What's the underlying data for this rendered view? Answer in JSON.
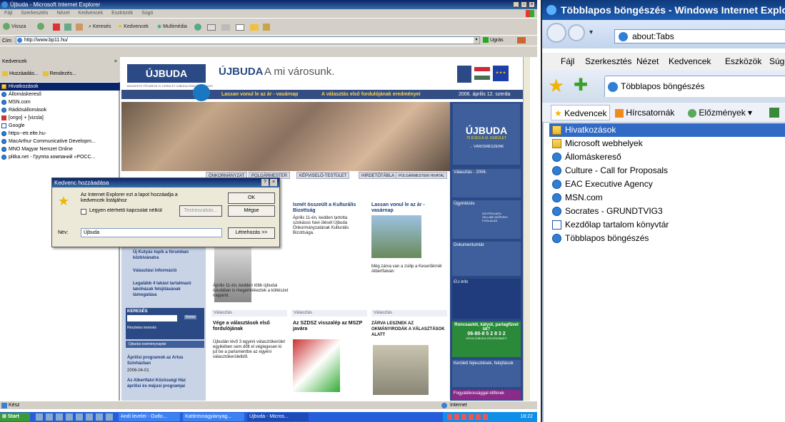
{
  "win1": {
    "title": "Újbuda - Microsoft Internet Explorer",
    "menu": [
      "Fájl",
      "Szerkesztés",
      "Nézet",
      "Kedvencek",
      "Eszközök",
      "Súgó"
    ],
    "toolbar": {
      "back": "Vissza",
      "search": "Keresés",
      "favorites": "Kedvencek",
      "media": "Multimédia"
    },
    "address_label": "Cím",
    "address": "http://www.bp11.hu/",
    "go": "Ugrás",
    "fav_title": "Kedvencek",
    "fav_add": "Hozzáadás...",
    "fav_org": "Rendezés...",
    "fav_items": [
      "Hivatkozások",
      "Állomáskereső",
      "MSN.com",
      "Rádiósállomások",
      "[origo] + [vizsla]",
      "Google",
      "https--etr.elte.hu-",
      "MacArthur Communicative Developm...",
      "MNO Magyar Nemzet Online",
      "plitka.net - Группа компаний «РОСС..."
    ],
    "status": "Kész",
    "status_zone": "Internet",
    "taskbar": {
      "start": "Start",
      "b1": "Andi levelei - Outlo...",
      "b2": "Kattintsnagyianyag...",
      "b3": "Újbuda - Micros...",
      "clock": "18:22"
    },
    "dialog": {
      "title": "Kedvenc hozzáadása",
      "msg": "Az Internet Explorer ezt a lapot hozzáadja a kedvencek listájához",
      "offline": "Legyen elérhető kapcsolat nélkül",
      "customize": "Testreszabás...",
      "ok": "OK",
      "cancel": "Mégse",
      "name_label": "Név:",
      "name_value": "Újbuda",
      "create": "Létrehozás >>"
    },
    "site": {
      "logo": "ÚJBUDA",
      "brand": "ÚJBUDA",
      "slogan": "A mi városunk.",
      "subtitle": "BUDAPEST FŐVÁROS XI. KERÜLET ÚJBUDA ÖNKORMÁNYZATA",
      "nav1": "Lassan vonul le az ár - vasárnap",
      "nav2": "A választás első fordulójának eredményei",
      "date": "2006. április 12. szerda",
      "hero_badge": "ÚJBUDA",
      "hero_badge2": "75 ÉVES A XI. KERÜLET",
      "hero_link": "→ VÁROSRÉSZEINK",
      "tabs": [
        "ÖNKORMÁNYZAT",
        "POLGÁRMESTER",
        "KÉPVISELŐ-TESTÜLET",
        "HIRDETŐTÁBLA",
        "POLGÁRMESTERI HIVATAL"
      ],
      "left_links": [
        "Új Kutyás topik a fórumban közkívánatra",
        "Választási információ",
        "Legalább 4 lakást tartalmazó lakóházak felújításának támogatása"
      ],
      "search_title": "KERESÉS",
      "search_btn": "Keres",
      "search_adv": "Részletes keresés",
      "events_title": "Újbudai eseménynaptár",
      "ev1": "Áprilisi programok az Artus Színházban",
      "ev1_date": "2006-04-01",
      "ev2": "Az Albertfalvi Közösségi Ház áprilisi és májusi programjai",
      "a1_title": "Ismét összeült a Kulturális Bizottság",
      "a1_text": "Április 11-én, kedden tartotta szokásos havi ülését Újbuda Önkormányzatának Kulturális Bizottsága.",
      "a2_title": "Lassan vonul le az ár - vasárnap",
      "a2_text": "Még zárva van a zsilip a Keserűérnél Albertfalván",
      "a3_text": "Április 11-én, kedden több újbudai iskolában is megemlékeztek a költészet napjáról.",
      "sec": "Választás",
      "b1_title": "Vége a választások első fordulójának",
      "b1_text": "Újbudán lévő 3 egyéni választókerület egyikében sem dőlt el véglegesen ki jut be a parlamentbe az egyéni választókerületből.",
      "b2_title": "Az SZDSZ visszalép az MSZP javára",
      "b3_title": "ZÁRVA LESZNEK AZ OKMÁNYIRODÁK A VÁLASZTÁSOK ALATT",
      "r1": "Választás - 2006.",
      "r2": "Ügyintézés",
      "r2b": "ÜGYFÉLKAPU",
      "r2c": "ON-LINE IDŐPONT-FOGLALÁS",
      "r3": "Dokumentumtár",
      "r4": "EU-Info",
      "r5": "Roncsautót, kátyút, parlagfüvet lát?",
      "r5_phone": "06-80-8 5 2 8 3 2",
      "r5b": "HÍVJA ÚJBUDA ZÖLDSZÁMÁT!",
      "r6": "Kerületi fejlesztések, felújítások",
      "r7": "Fogyatékossággal élőknek"
    }
  },
  "win2": {
    "title": "Többlapos böngészés - Windows Internet Explorer",
    "address": "about:Tabs",
    "menu": [
      "Fájl",
      "Szerkesztés",
      "Nézet",
      "Kedvencek",
      "Eszközök",
      "Súgó"
    ],
    "tab": "Többlapos böngészés",
    "fav_tabs": {
      "favorites": "Kedvencek",
      "feeds": "Hírcsatornák",
      "history": "Előzmények"
    },
    "items": [
      "Hivatkozások",
      "Microsoft webhelyek",
      "Állomáskereső",
      "Culture - Call for Proposals",
      "EAC Executive Agency",
      "MSN.com",
      "Socrates - GRUNDTVIG3",
      "Kezdőlap tartalom könyvtár",
      "Többlapos böngészés"
    ]
  },
  "colors": {
    "xp_title": "#0a246a",
    "site_blue": "#2b4a85",
    "ie7_title": "#0f3a7a",
    "selection": "#316ac5"
  }
}
